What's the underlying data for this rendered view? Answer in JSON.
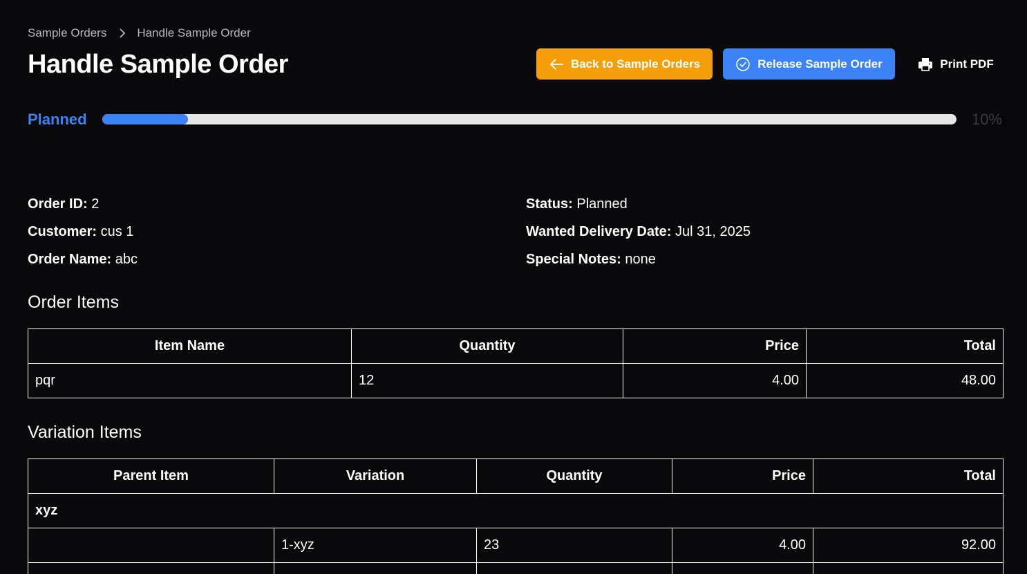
{
  "breadcrumb": {
    "parent": "Sample Orders",
    "current": "Handle Sample Order"
  },
  "page": {
    "title": "Handle Sample Order"
  },
  "actions": {
    "back_label": "Back to Sample Orders",
    "release_label": "Release Sample Order",
    "print_label": "Print PDF"
  },
  "progress": {
    "label": "Planned",
    "percent_text": "10%",
    "value": 0.1,
    "fill_color": "#3b82f6",
    "track_color": "#e5e5e5"
  },
  "details": {
    "order_id_label": "Order ID:",
    "order_id_value": "2",
    "customer_label": "Customer:",
    "customer_value": "cus 1",
    "order_name_label": "Order Name:",
    "order_name_value": "abc",
    "status_label": "Status:",
    "status_value": "Planned",
    "delivery_label": "Wanted Delivery Date:",
    "delivery_value": "Jul 31, 2025",
    "notes_label": "Special Notes:",
    "notes_value": "none"
  },
  "order_items": {
    "title": "Order Items",
    "headers": [
      "Item Name",
      "Quantity",
      "Price",
      "Total"
    ],
    "rows": [
      [
        "pqr",
        "12",
        "4.00",
        "48.00"
      ]
    ]
  },
  "variation_items": {
    "title": "Variation Items",
    "headers": [
      "Parent Item",
      "Variation",
      "Quantity",
      "Price",
      "Total"
    ],
    "group": "xyz",
    "rows": [
      [
        "",
        "1-xyz",
        "23",
        "4.00",
        "92.00"
      ]
    ]
  },
  "colors": {
    "background": "#09090b",
    "back_button": "#f59e0b",
    "release_button": "#3b82f6",
    "status_accent": "#3b82f6"
  }
}
